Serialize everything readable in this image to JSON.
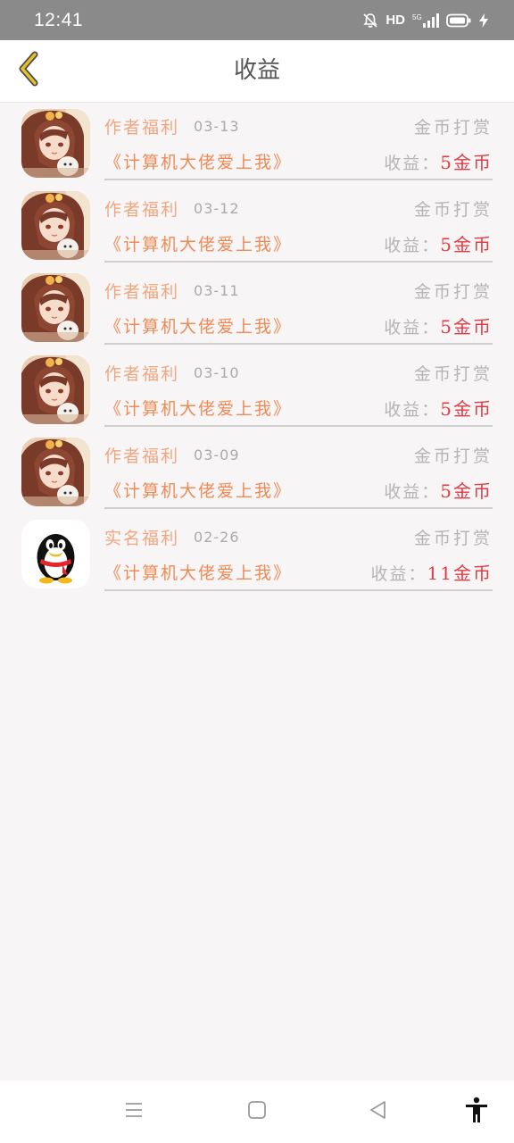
{
  "status_bar": {
    "time": "12:41",
    "hd_label": "HD",
    "icons": [
      "bell-mute-icon",
      "signal-icon",
      "battery-icon",
      "charging-icon"
    ]
  },
  "header": {
    "title": "收益",
    "back_icon": "chevron-left-icon"
  },
  "colors": {
    "type_label": "#f0a780",
    "book_title": "#f08a55",
    "income_amount": "#e03a42",
    "muted": "#b5b5b5",
    "back_icon": "#e6c02a"
  },
  "items": [
    {
      "avatar": "anime-girl-avatar",
      "type": "作者福利",
      "date": "03-13",
      "reward_type": "金币打赏",
      "book": "《计算机大佬爱上我》",
      "income_label": "收益：",
      "income_amount": "5金币"
    },
    {
      "avatar": "anime-girl-avatar",
      "type": "作者福利",
      "date": "03-12",
      "reward_type": "金币打赏",
      "book": "《计算机大佬爱上我》",
      "income_label": "收益：",
      "income_amount": "5金币"
    },
    {
      "avatar": "anime-girl-avatar",
      "type": "作者福利",
      "date": "03-11",
      "reward_type": "金币打赏",
      "book": "《计算机大佬爱上我》",
      "income_label": "收益：",
      "income_amount": "5金币"
    },
    {
      "avatar": "anime-girl-avatar",
      "type": "作者福利",
      "date": "03-10",
      "reward_type": "金币打赏",
      "book": "《计算机大佬爱上我》",
      "income_label": "收益：",
      "income_amount": "5金币"
    },
    {
      "avatar": "anime-girl-avatar",
      "type": "作者福利",
      "date": "03-09",
      "reward_type": "金币打赏",
      "book": "《计算机大佬爱上我》",
      "income_label": "收益：",
      "income_amount": "5金币"
    },
    {
      "avatar": "qq-penguin-avatar",
      "type": "实名福利",
      "date": "02-26",
      "reward_type": "金币打赏",
      "book": "《计算机大佬爱上我》",
      "income_label": "收益：",
      "income_amount": "11金币"
    }
  ],
  "nav_bar": {
    "icons": [
      "menu-icon",
      "home-icon",
      "back-triangle-icon",
      "accessibility-icon"
    ]
  }
}
